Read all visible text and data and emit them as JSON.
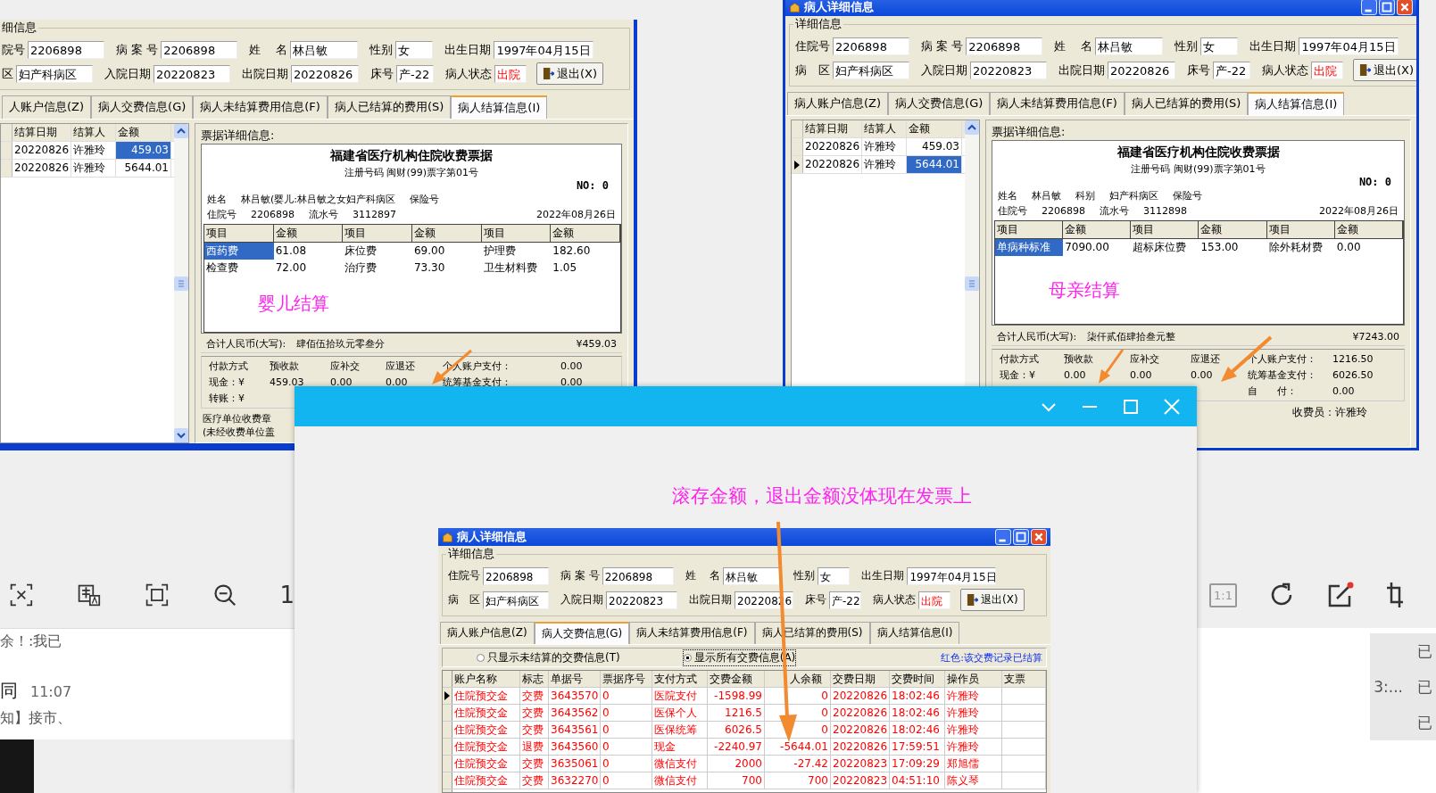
{
  "windows": [
    {
      "kind": "settlement",
      "group_title": "细信息",
      "fields": [
        [
          {
            "label": "院号",
            "value": "2206898"
          },
          {
            "label": "病 案 号",
            "value": "2206898"
          },
          {
            "label": "姓　 名",
            "value": "林吕敏"
          },
          {
            "label": "性别",
            "value": "女"
          },
          {
            "label": "出生日期",
            "value": "1997年04月15日"
          }
        ],
        [
          {
            "label": "区",
            "value": "妇产科病区"
          },
          {
            "label": "入院日期",
            "value": "20220823"
          },
          {
            "label": "出院日期",
            "value": "20220826"
          },
          {
            "label": "床号",
            "value": "产-22"
          },
          {
            "label": "病人状态",
            "value": "出院",
            "kind": "status"
          }
        ]
      ],
      "exit_button": "退出(X)",
      "tabs": [
        {
          "label": "人账户信息(Z)",
          "selected": false
        },
        {
          "label": "病人交费信息(G)",
          "selected": false
        },
        {
          "label": "病人未结算费用信息(F)",
          "selected": false
        },
        {
          "label": "病人已结算的费用(S)",
          "selected": false
        },
        {
          "label": "病人结算信息(I)",
          "selected": true
        }
      ],
      "settlement": {
        "columns": [
          "结算日期",
          "结算人",
          "金额"
        ],
        "rows": [
          {
            "date": "20220826",
            "person": "许雅玲",
            "amount": "459.03",
            "selected": true,
            "current": false
          },
          {
            "date": "20220826",
            "person": "许雅玲",
            "amount": "5644.01",
            "selected": false,
            "current": false
          }
        ],
        "receipt": {
          "panel_title": "票据详细信息:",
          "title": "福建省医疗机构住院收费票据",
          "subtitle": "注册号码 闽财(99)票字第01号",
          "number": "NO: 0",
          "info_1": [
            "姓名",
            "林吕敏(婴儿:林吕敏之女妇产科病区",
            "保险号"
          ],
          "info_2": [
            "住院号",
            "2206898",
            "流水号",
            "3112897"
          ],
          "date": "2022年08月26日",
          "columns": [
            "项目",
            "金额",
            "项目",
            "金额",
            "项目",
            "金额"
          ],
          "items": [
            {
              "name": "西药费",
              "amount": "61.08",
              "selected": true
            },
            {
              "name": "床位费",
              "amount": "69.00",
              "selected": false
            },
            {
              "name": "护理费",
              "amount": "182.60",
              "selected": false
            },
            {
              "name": "检查费",
              "amount": "72.00",
              "selected": false
            },
            {
              "name": "治疗费",
              "amount": "73.30",
              "selected": false
            },
            {
              "name": "卫生材料费",
              "amount": "1.05",
              "selected": false
            }
          ],
          "annotation": "婴儿结算",
          "total_label": "合计人民币(大写):",
          "total_words": "肆佰伍拾玖元零叁分",
          "total_amount": "¥459.03",
          "payments": [
            {
              "kind": "full",
              "cells": [
                "付款方式",
                "预收款",
                "应补交",
                "应退还",
                "个人账户支付：",
                "0.00"
              ]
            },
            {
              "kind": "full",
              "cells": [
                "现金：¥",
                "459.03",
                "0.00",
                "0.00",
                "统筹基金支付：",
                "0.00"
              ]
            },
            {
              "kind": "lead",
              "cells": [
                "转账：¥"
              ]
            }
          ],
          "footer": [
            {
              "kind": "stamp",
              "text": "医疗单位收费章"
            },
            {
              "kind": "stamp",
              "text": "(未经收费单位盖"
            }
          ]
        }
      }
    },
    {
      "kind": "settlement",
      "title": "病人详细信息",
      "group_title": "详细信息",
      "fields": [
        [
          {
            "label": "住院号",
            "value": "2206898"
          },
          {
            "label": "病 案 号",
            "value": "2206898"
          },
          {
            "label": "姓　 名",
            "value": "林吕敏"
          },
          {
            "label": "性别",
            "value": "女"
          },
          {
            "label": "出生日期",
            "value": "1997年04月15日"
          }
        ],
        [
          {
            "label": "病　区",
            "value": "妇产科病区"
          },
          {
            "label": "入院日期",
            "value": "20220823"
          },
          {
            "label": "出院日期",
            "value": "20220826"
          },
          {
            "label": "床号",
            "value": "产-22"
          },
          {
            "label": "病人状态",
            "value": "出院",
            "kind": "status"
          }
        ]
      ],
      "exit_button": "退出(X)",
      "tabs": [
        {
          "label": "病人账户信息(Z)",
          "selected": false
        },
        {
          "label": "病人交费信息(G)",
          "selected": false
        },
        {
          "label": "病人未结算费用信息(F)",
          "selected": false
        },
        {
          "label": "病人已结算的费用(S)",
          "selected": false
        },
        {
          "label": "病人结算信息(I)",
          "selected": true
        }
      ],
      "settlement": {
        "columns": [
          "结算日期",
          "结算人",
          "金额"
        ],
        "rows": [
          {
            "date": "20220826",
            "person": "许雅玲",
            "amount": "459.03",
            "selected": false,
            "current": false
          },
          {
            "date": "20220826",
            "person": "许雅玲",
            "amount": "5644.01",
            "selected": true,
            "current": true
          }
        ],
        "receipt": {
          "panel_title": "票据详细信息:",
          "title": "福建省医疗机构住院收费票据",
          "subtitle": "注册号码 闽财(99)票字第01号",
          "number": "NO: 0",
          "info_1": [
            "姓名",
            "林吕敏",
            "科别",
            "妇产科病区",
            "保险号"
          ],
          "info_2": [
            "住院号",
            "2206898",
            "流水号",
            "3112898"
          ],
          "date": "2022年08月26日",
          "columns": [
            "项目",
            "金额",
            "项目",
            "金额",
            "项目",
            "金额"
          ],
          "items": [
            {
              "name": "单病种标准",
              "amount": "7090.00",
              "selected": true
            },
            {
              "name": "超标床位费",
              "amount": "153.00",
              "selected": false
            },
            {
              "name": "除外耗材费",
              "amount": "0.00",
              "selected": false
            }
          ],
          "annotation": "母亲结算",
          "total_label": "合计人民币(大写):",
          "total_words": "柒仟贰佰肆拾叁元整",
          "total_amount": "¥7243.00",
          "payments": [
            {
              "kind": "full",
              "cells": [
                "付款方式",
                "预收款",
                "应补交",
                "应退还",
                "个人账户支付：",
                "1216.50"
              ]
            },
            {
              "kind": "full",
              "cells": [
                "现金：¥",
                "0.00",
                "0.00",
                "0.00",
                "统筹基金支付：",
                "6026.50"
              ]
            },
            {
              "kind": "tail",
              "cells": [
                "自　　付：",
                "0.00"
              ]
            }
          ],
          "footer": [
            {
              "kind": "cashier",
              "text": "收费员：许雅玲"
            }
          ]
        }
      }
    }
  ],
  "popup": {
    "annotation": "滚存金额，退出金额没体现在发票上",
    "embedded_window": {
      "kind": "payments",
      "title": "病人详细信息",
      "group_title": "详细信息",
      "fields": [
        [
          {
            "label": "住院号",
            "value": "2206898"
          },
          {
            "label": "病 案 号",
            "value": "2206898"
          },
          {
            "label": "姓　 名",
            "value": "林吕敏"
          },
          {
            "label": "性别",
            "value": "女"
          },
          {
            "label": "出生日期",
            "value": "1997年04月15日"
          }
        ],
        [
          {
            "label": "病　区",
            "value": "妇产科病区"
          },
          {
            "label": "入院日期",
            "value": "20220823"
          },
          {
            "label": "出院日期",
            "value": "20220826"
          },
          {
            "label": "床号",
            "value": "产-22"
          },
          {
            "label": "病人状态",
            "value": "出院",
            "kind": "status"
          }
        ]
      ],
      "exit_button": "退出(X)",
      "tabs": [
        {
          "label": "病人账户信息(Z)",
          "selected": false
        },
        {
          "label": "病人交费信息(G)",
          "selected": true
        },
        {
          "label": "病人未结算费用信息(F)",
          "selected": false
        },
        {
          "label": "病人已结算的费用(S)",
          "selected": false
        },
        {
          "label": "病人结算信息(I)",
          "selected": false
        }
      ],
      "payments": {
        "radios": [
          {
            "label": "只显示未结算的交费信息(T)",
            "selected": false
          },
          {
            "label": "显示所有交费信息(A)",
            "selected": true
          }
        ],
        "legend": "红色:该交费记录已结算",
        "columns": [
          "账户名称",
          "标志",
          "单据号",
          "票据序号",
          "支付方式",
          "交费金额",
          "人余额",
          "交费日期",
          "交费时间",
          "操作员",
          "支票"
        ],
        "rows": [
          {
            "current": true,
            "settled": true,
            "cells": [
              "住院预交金",
              "交费",
              "3643570",
              "0",
              "医院支付",
              "-1598.99",
              "0",
              "20220826",
              "18:02:46",
              "许雅玲"
            ]
          },
          {
            "current": false,
            "settled": true,
            "cells": [
              "住院预交金",
              "交费",
              "3643562",
              "0",
              "医保个人",
              "1216.5",
              "0",
              "20220826",
              "18:02:46",
              "许雅玲"
            ]
          },
          {
            "current": false,
            "settled": true,
            "cells": [
              "住院预交金",
              "交费",
              "3643561",
              "0",
              "医保统筹",
              "6026.5",
              "0",
              "20220826",
              "18:02:46",
              "许雅玲"
            ]
          },
          {
            "current": false,
            "settled": true,
            "cells": [
              "住院预交金",
              "退费",
              "3643560",
              "0",
              "现金",
              "-2240.97",
              "-5644.01",
              "20220826",
              "17:59:51",
              "许雅玲"
            ]
          },
          {
            "current": false,
            "settled": true,
            "cells": [
              "住院预交金",
              "交费",
              "3635061",
              "0",
              "微信支付",
              "2000",
              "-27.42",
              "20220823",
              "17:09:29",
              "郑旭儒"
            ]
          },
          {
            "current": false,
            "settled": true,
            "cells": [
              "住院预交金",
              "交费",
              "3632270",
              "0",
              "微信支付",
              "700",
              "700",
              "20220823",
              "04:51:10",
              "陈义琴"
            ]
          }
        ]
      }
    }
  },
  "background": {
    "left_toolbar_text": "1",
    "chat": [
      {
        "text": "余！:我已"
      },
      {
        "text": "同",
        "time": "11:07"
      },
      {
        "text": "知】接市、"
      }
    ],
    "right_toolbar_text": "1:1",
    "right_list": [
      [
        "已"
      ],
      [
        "3:...",
        "已"
      ],
      [
        "已"
      ]
    ]
  }
}
